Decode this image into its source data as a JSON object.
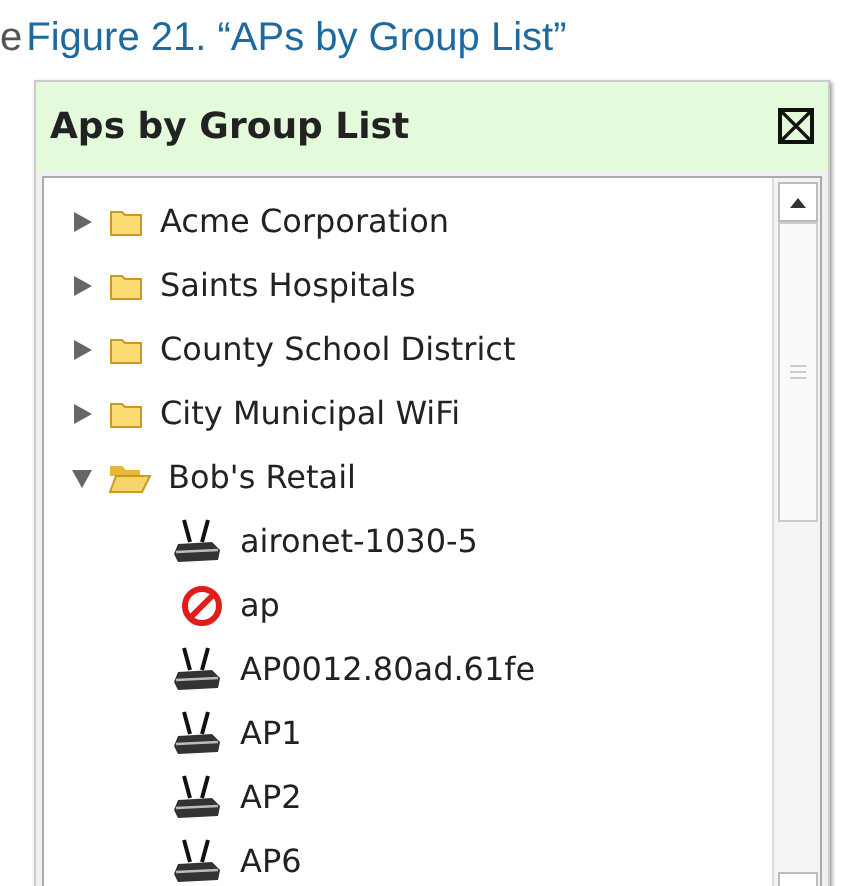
{
  "page_fragment": "e",
  "caption": "Figure 21. “APs by Group List”",
  "panel": {
    "title": "Aps by Group List",
    "tree": [
      {
        "label": "Acme Corporation",
        "expanded": false
      },
      {
        "label": "Saints Hospitals",
        "expanded": false
      },
      {
        "label": "County School District",
        "expanded": false
      },
      {
        "label": "City Municipal WiFi",
        "expanded": false
      },
      {
        "label": "Bob's Retail",
        "expanded": true,
        "children": [
          {
            "label": "aironet-1030-5",
            "kind": "ap"
          },
          {
            "label": "ap",
            "kind": "blocked"
          },
          {
            "label": "AP0012.80ad.61fe",
            "kind": "ap"
          },
          {
            "label": "AP1",
            "kind": "ap"
          },
          {
            "label": "AP2",
            "kind": "ap"
          },
          {
            "label": "AP6",
            "kind": "ap"
          }
        ]
      }
    ]
  }
}
